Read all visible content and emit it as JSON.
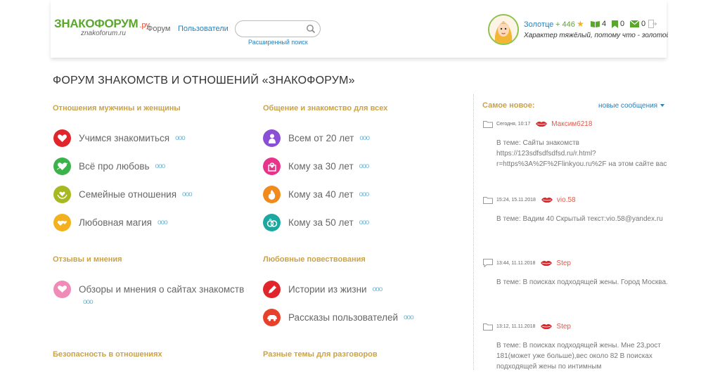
{
  "header": {
    "logo_main": "ЗНАКОФОРУМ",
    "logo_tld": ".ру",
    "logo_sub": "znakoforum.ru",
    "nav": {
      "forum": "Форум",
      "users": "Пользователи"
    },
    "search": {
      "placeholder": "",
      "advanced": "Расширенный поиск"
    },
    "user": {
      "name": "Золотце",
      "reputation": "+ 446",
      "messages_count": "4",
      "bookmarks_count": "0",
      "mail_count": "0",
      "status": "Характер тяжёлый, потому что - золотой (С,"
    }
  },
  "page_title": "ФОРУМ ЗНАКОМСТВ И ОТНОШЕНИЙ «ЗНАКОФОРУМ»",
  "categories": {
    "c1": {
      "title": "Отношения мужчины и женщины",
      "forums": [
        "Учимся знакомиться",
        "Всё про любовь",
        "Семейные отношения",
        "Любовная магия"
      ]
    },
    "c2": {
      "title": "Общение и знакомство для всех",
      "forums": [
        "Всем от 20 лет",
        "Кому за 30 лет",
        "Кому за 40 лет",
        "Кому за 50 лет"
      ]
    },
    "c3": {
      "title": "Отзывы и мнения",
      "forums": [
        "Обзоры и мнения о сайтах знакомств"
      ]
    },
    "c4": {
      "title": "Любовные повествования",
      "forums": [
        "Истории из жизни",
        "Рассказы пользователей"
      ]
    },
    "c5": {
      "title": "Безопасность в отношениях"
    },
    "c6": {
      "title": "Разные темы для разговоров"
    }
  },
  "dots": "ooo",
  "sidebar": {
    "title": "Самое новое:",
    "link": "новые сообщения",
    "entries": [
      {
        "date": "Сегодня, 10:17",
        "user": "Максим6218",
        "body": "В теме: Сайты знакомств https://123sdfsdfsdfsd.ru/r.html?r=https%3A%2F%2Flinkyou.ru%2F  на этом сайте вас"
      },
      {
        "date": "15:24, 15.11.2018",
        "user": "vio.58",
        "body": "В теме: Вадим 40 Скрытый текст:vio.58@yandex.ru"
      },
      {
        "date": "13:44, 11.11.2018",
        "user": "Step",
        "body": "В теме: В поисках подходящей жены. Город Москва."
      },
      {
        "date": "13:12, 11.11.2018",
        "user": "Step",
        "body": "В теме: В поисках подходящей жены. Мне 23,рост 181(может уже больше),вес около 82 В поисках подходящей жены по интимным"
      }
    ]
  },
  "colors": {
    "accent_gold": "#c9a24a",
    "link_blue": "#2a7fb8",
    "icon_red": "#e0262b",
    "icon_green": "#3cb34a",
    "icon_olive": "#a8b820",
    "icon_yellow": "#f3b21d",
    "icon_purple": "#8b4fd6",
    "icon_pink": "#e8338a",
    "icon_orange": "#f08a1c",
    "icon_teal": "#1aa8a0",
    "icon_lightpink": "#f08ab6",
    "icon_redorange": "#e8412b"
  }
}
